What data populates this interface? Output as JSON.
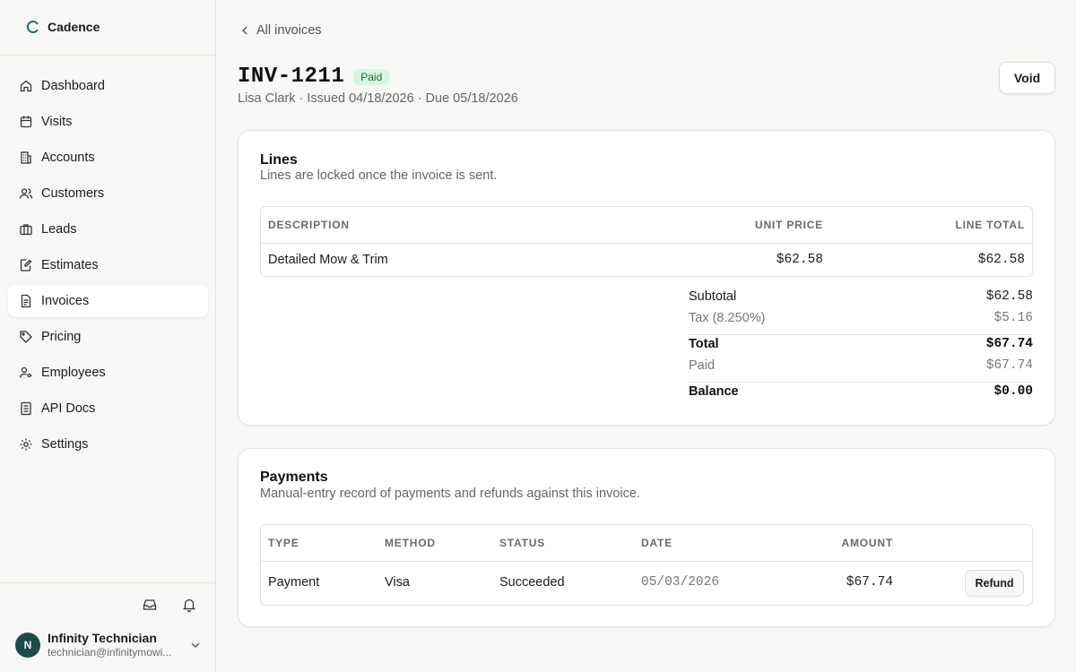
{
  "app": {
    "name": "Cadence",
    "accent": "#1f4a4a"
  },
  "sidebar": {
    "items": [
      {
        "label": "Dashboard",
        "icon": "home-icon"
      },
      {
        "label": "Visits",
        "icon": "calendar-icon"
      },
      {
        "label": "Accounts",
        "icon": "building-icon"
      },
      {
        "label": "Customers",
        "icon": "users-icon"
      },
      {
        "label": "Leads",
        "icon": "briefcase-icon"
      },
      {
        "label": "Estimates",
        "icon": "edit-doc-icon"
      },
      {
        "label": "Invoices",
        "icon": "document-icon",
        "active": true
      },
      {
        "label": "Pricing",
        "icon": "tag-icon"
      },
      {
        "label": "Employees",
        "icon": "user-key-icon"
      },
      {
        "label": "API Docs",
        "icon": "book-icon"
      },
      {
        "label": "Settings",
        "icon": "gear-icon"
      }
    ],
    "tools": [
      "inbox-icon",
      "bell-icon"
    ]
  },
  "user": {
    "initial": "N",
    "name": "Infinity Technician",
    "email": "technician@infinitymowi..."
  },
  "header": {
    "back_label": "All invoices",
    "invoice_number": "INV-1211",
    "status": "Paid",
    "subtitle": "Lisa Clark · Issued 04/18/2026 · Due 05/18/2026",
    "void_label": "Void"
  },
  "lines": {
    "title": "Lines",
    "description": "Lines are locked once the invoice is sent.",
    "columns": [
      "DESCRIPTION",
      "UNIT PRICE",
      "LINE TOTAL"
    ],
    "rows": [
      {
        "description": "Detailed Mow & Trim",
        "unit_price": "$62.58",
        "line_total": "$62.58"
      }
    ],
    "totals": {
      "subtotal_label": "Subtotal",
      "subtotal": "$62.58",
      "tax_label": "Tax (8.250%)",
      "tax": "$5.16",
      "total_label": "Total",
      "total": "$67.74",
      "paid_label": "Paid",
      "paid": "$67.74",
      "balance_label": "Balance",
      "balance": "$0.00"
    }
  },
  "payments": {
    "title": "Payments",
    "description": "Manual-entry record of payments and refunds against this invoice.",
    "columns": [
      "TYPE",
      "METHOD",
      "STATUS",
      "DATE",
      "AMOUNT"
    ],
    "rows": [
      {
        "type": "Payment",
        "method": "Visa",
        "status": "Succeeded",
        "date": "05/03/2026",
        "amount": "$67.74",
        "action": "Refund"
      }
    ]
  }
}
